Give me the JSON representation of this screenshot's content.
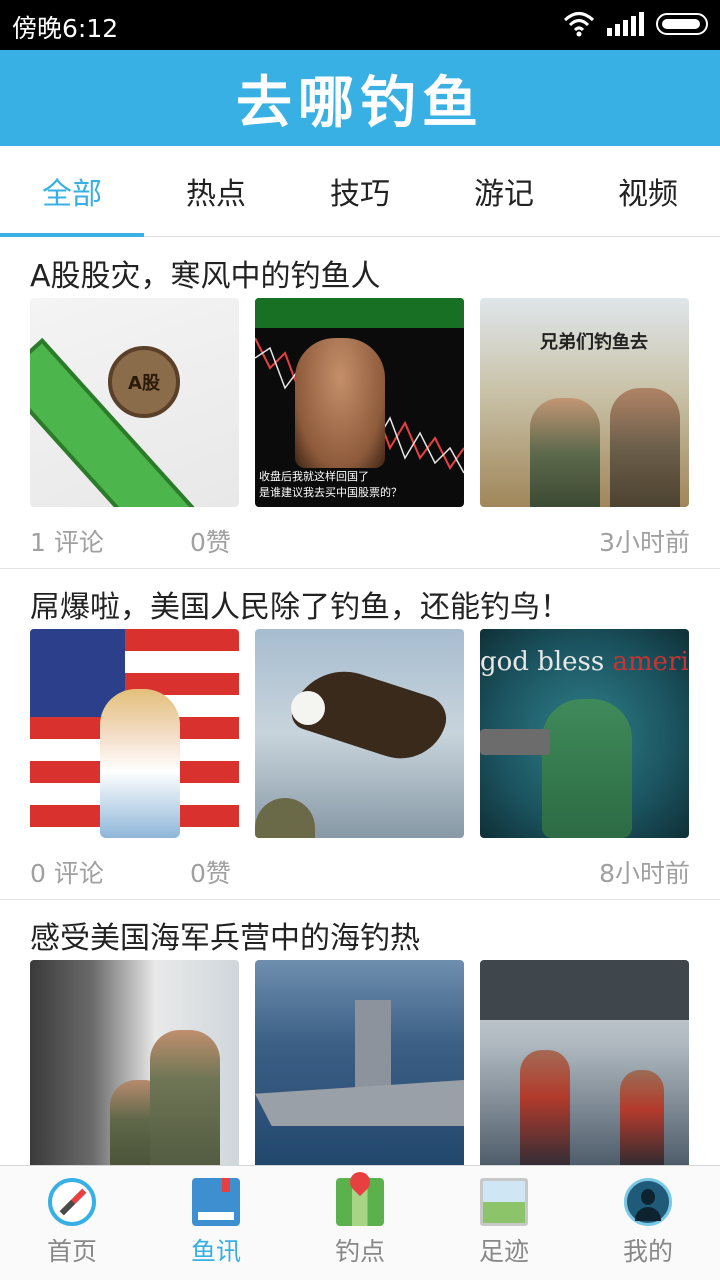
{
  "status_bar": {
    "time": "傍晚6:12"
  },
  "header": {
    "title": "去哪钓鱼"
  },
  "tabs": [
    {
      "label": "全部",
      "active": true
    },
    {
      "label": "热点",
      "active": false
    },
    {
      "label": "技巧",
      "active": false
    },
    {
      "label": "游记",
      "active": false
    },
    {
      "label": "视频",
      "active": false
    }
  ],
  "posts": [
    {
      "title": "A股股灾，寒风中的钓鱼人",
      "comments": "1 评论",
      "likes": "0赞",
      "time": "3小时前",
      "thumb_texts": {
        "coin": "A股",
        "caption": "收盘后我就这样回国了\n是谁建议我去买中国股票的？",
        "war": "兄弟们钓鱼去"
      }
    },
    {
      "title": "屌爆啦，美国人民除了钓鱼，还能钓鸟！",
      "comments": "0 评论",
      "likes": "0赞",
      "time": "8小时前",
      "thumb_texts": {
        "liberty_a": "god bless ",
        "liberty_b": "america"
      }
    },
    {
      "title": "感受美国海军兵营中的海钓热",
      "comments": "",
      "likes": "",
      "time": ""
    }
  ],
  "bottom_nav": [
    {
      "label": "首页",
      "icon": "compass-icon",
      "active": false
    },
    {
      "label": "鱼讯",
      "icon": "book-icon",
      "active": true
    },
    {
      "label": "钓点",
      "icon": "map-pin-icon",
      "active": false
    },
    {
      "label": "足迹",
      "icon": "photo-icon",
      "active": false
    },
    {
      "label": "我的",
      "icon": "avatar-icon",
      "active": false
    }
  ],
  "colors": {
    "accent": "#38b0e3",
    "status_bar": "#000000",
    "meta_text": "#a0a0a0"
  }
}
